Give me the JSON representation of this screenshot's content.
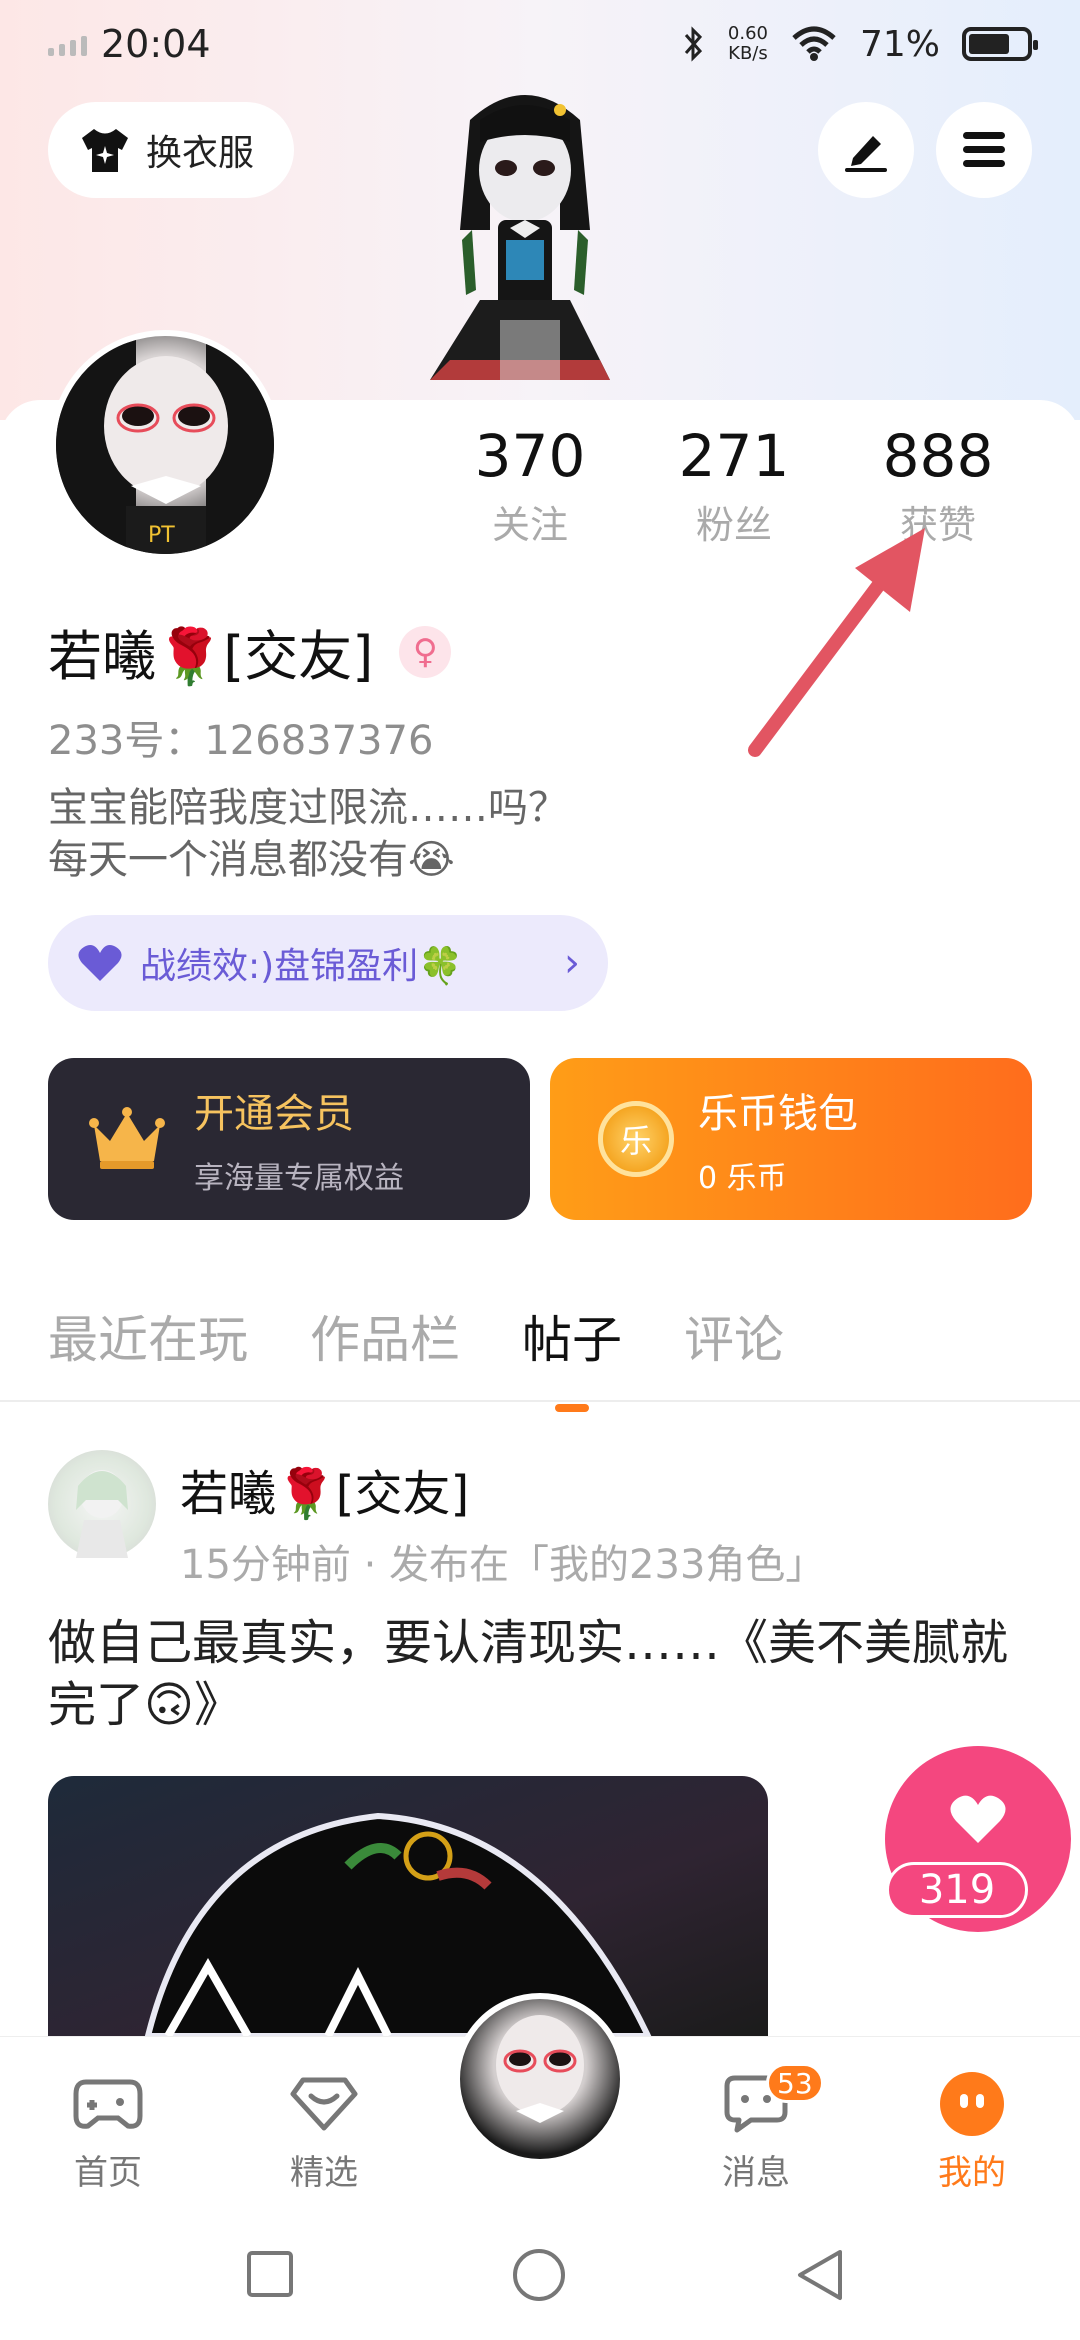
{
  "status_bar": {
    "time": "20:04",
    "net_speed_value": "0.60",
    "net_speed_unit": "KB/s",
    "battery": "71%"
  },
  "header": {
    "outfit_label": "换衣服"
  },
  "profile": {
    "stats": [
      {
        "value": "370",
        "label": "关注"
      },
      {
        "value": "271",
        "label": "粉丝"
      },
      {
        "value": "888",
        "label": "获赞"
      }
    ],
    "nickname": "若曦🌹[交友]",
    "gender_symbol": "♀",
    "uid": "233号：126837376",
    "bio_line1": "宝宝能陪我度过限流……吗？",
    "bio_line2": "每天一个消息都没有😭",
    "record_label": "战绩效:)盘锦盈利🍀"
  },
  "cards": {
    "vip_title": "开通会员",
    "vip_sub": "享海量专属权益",
    "wallet_title": "乐币钱包",
    "wallet_sub": "0 乐币",
    "coin_glyph": "乐"
  },
  "tabs": [
    "最近在玩",
    "作品栏",
    "帖子",
    "评论"
  ],
  "post": {
    "author": "若曦🌹[交友]",
    "meta": "15分钟前 · 发布在「我的233角色」",
    "text": "做自己最真实，要认清现实……《美不美腻就完了🙃》",
    "likes": "319"
  },
  "bottom_nav": {
    "home": "首页",
    "featured": "精选",
    "messages": "消息",
    "messages_badge": "53",
    "mine": "我的"
  },
  "colors": {
    "accent": "#ff7a1a",
    "like": "#f4477f",
    "record": "#6a5bd6",
    "vip_gold": "#f6c35f"
  }
}
